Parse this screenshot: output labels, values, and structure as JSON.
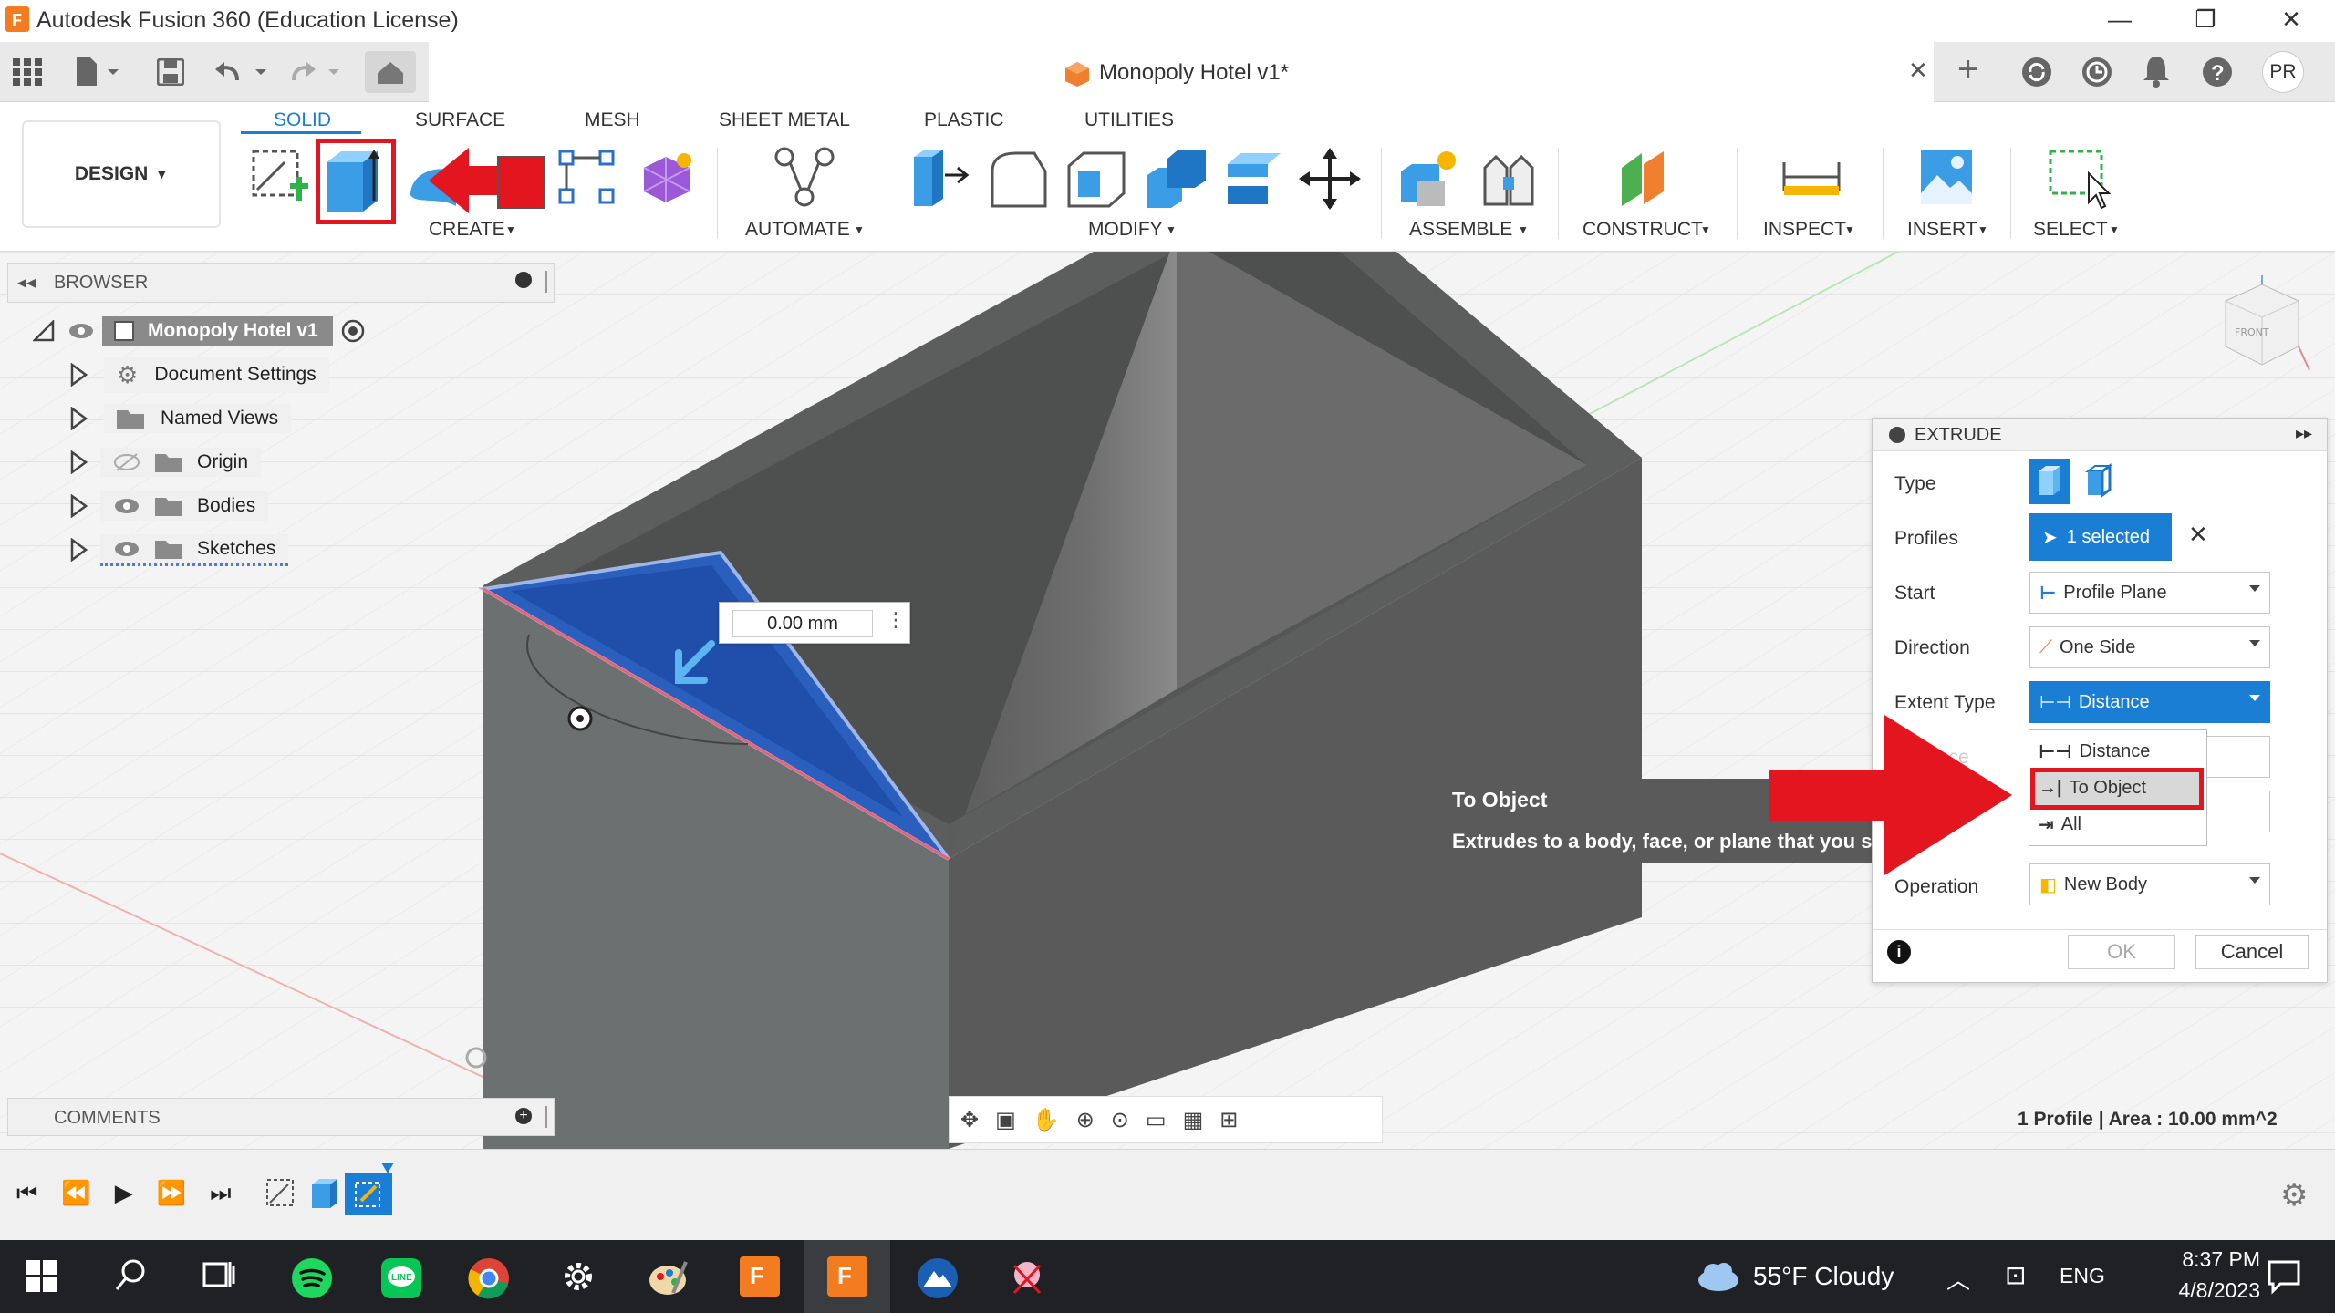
{
  "titlebar": {
    "app_title": "Autodesk Fusion 360 (Education License)",
    "minimize": "—",
    "restore": "❐",
    "close": "✕"
  },
  "tabbar": {
    "document_title": "Monopoly Hotel v1*",
    "tab_close": "✕",
    "new_tab": "+",
    "user_initials": "PR"
  },
  "ribbon": {
    "tabs": [
      "SOLID",
      "SURFACE",
      "MESH",
      "SHEET METAL",
      "PLASTIC",
      "UTILITIES"
    ],
    "active_tab": "SOLID",
    "workspace": "DESIGN",
    "groups": [
      "CREATE",
      "AUTOMATE",
      "MODIFY",
      "ASSEMBLE",
      "CONSTRUCT",
      "INSPECT",
      "INSERT",
      "SELECT"
    ]
  },
  "browser": {
    "title": "BROWSER",
    "root": "Monopoly Hotel v1",
    "items": [
      "Document Settings",
      "Named Views",
      "Origin",
      "Bodies",
      "Sketches"
    ]
  },
  "comments": {
    "title": "COMMENTS"
  },
  "viewport": {
    "distance_value": "0.00 mm",
    "status_text": "1 Profile | Area : 10.00 mm^2",
    "viewcube_label": "FRONT"
  },
  "extrude": {
    "title": "EXTRUDE",
    "labels": {
      "type": "Type",
      "profiles": "Profiles",
      "start": "Start",
      "direction": "Direction",
      "extent_type": "Extent Type",
      "distance": "Distance",
      "operation": "Operation"
    },
    "profiles_value": "1 selected",
    "start_value": "Profile Plane",
    "direction_value": "One Side",
    "extent_type_value": "Distance",
    "operation_value": "New Body",
    "ok": "OK",
    "cancel": "Cancel"
  },
  "extent_dropdown": {
    "options": [
      "Distance",
      "To Object",
      "All"
    ],
    "highlighted": "To Object"
  },
  "tooltip": {
    "title": "To Object",
    "description": "Extrudes to a body, face, or plane that you select."
  },
  "taskbar": {
    "weather": "55°F  Cloudy",
    "language": "ENG",
    "time": "8:37 PM",
    "date": "4/8/2023"
  },
  "colors": {
    "accent": "#1a7fd4",
    "annotation_red": "#e3151f",
    "profile_blue": "#2a5fbd",
    "model_gray": "#5f6060",
    "taskbar": "#202124"
  }
}
